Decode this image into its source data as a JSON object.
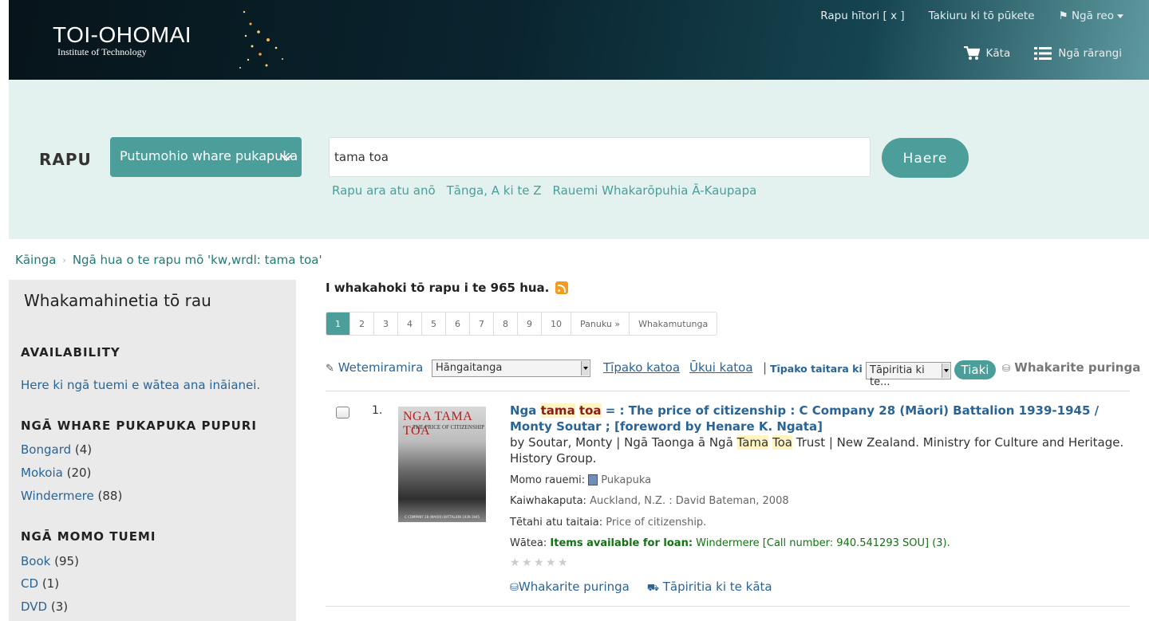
{
  "header": {
    "brand": "TOI-OHOMAI",
    "brand_sub": "Institute of Technology",
    "top_links": [
      "Rapu hītori [ x ]",
      "Takiuru ki tō pūkete",
      "Ngā reo"
    ],
    "cart_label": "Kāta",
    "lists_label": "Ngā rārangi"
  },
  "search": {
    "label": "RAPU",
    "scope": "Putumohio whare pukapuka",
    "query": "tama toa",
    "go_label": "Haere",
    "links": [
      "Rapu ara atu anō",
      "Tānga, A ki te Z",
      "Rauemi Whakarōpuhia Ā-Kaupapa"
    ]
  },
  "breadcrumb": {
    "home": "Kāinga",
    "current": "Ngā hua o te rapu mō 'kw,wrdl: tama toa'"
  },
  "sidebar": {
    "title": "Whakamahinetia tō rau",
    "availability_heading": "AVAILABILITY",
    "availability_link": "Here ki ngā tuemi e wātea ana ināianei.",
    "libraries_heading": "NGĀ WHARE PUKAPUKA PUPURI",
    "libraries": [
      {
        "name": "Bongard",
        "count": "(4)"
      },
      {
        "name": "Mokoia",
        "count": "(20)"
      },
      {
        "name": "Windermere",
        "count": "(88)"
      }
    ],
    "types_heading": "NGĀ MOMO TUEMI",
    "types": [
      {
        "name": "Book",
        "count": "(95)"
      },
      {
        "name": "CD",
        "count": "(1)"
      },
      {
        "name": "DVD",
        "count": "(3)"
      }
    ]
  },
  "results": {
    "hits_text": "I whakahoki tō rapu i te 965 hua.",
    "pages": [
      "1",
      "2",
      "3",
      "4",
      "5",
      "6",
      "7",
      "8",
      "9",
      "10",
      "Panuku »",
      "Whakamutunga"
    ],
    "active_page": "1",
    "toolbar": {
      "highlight": "Wetemiramira",
      "sort": "Hāngaitanga",
      "select_all": "Tīpako katoa",
      "clear_all": "Ūkui katoa",
      "add_to_label": "Tīpako taitara ki te:",
      "add_to_select": "Tāpiritia ki te...",
      "save": "Tiaki",
      "place_hold": "Whakarite puringa"
    },
    "items": [
      {
        "number": "1.",
        "cover_title": "NGA TAMA TOA",
        "cover_sub": "THE PRICE OF CITIZENSHIP",
        "cover_foot": "C COMPANY 28 (MAORI) BATTALION 1939-1945",
        "title_pre": "Nga ",
        "title_hl1": "tama",
        "title_hl2": "toa",
        "title_post": " = : The price of citizenship : C Company 28 (Māori) Battalion 1939-1945 / Monty Soutar ; [foreword by Henare K. Ngata]",
        "author_pre": "by Soutar, Monty | Ngā Taonga ā Ngā ",
        "author_hl1": "Tama",
        "author_hl2": "Toa",
        "author_post": " Trust | New Zealand. Ministry for Culture and Heritage. History Group.",
        "type_label": "Momo rauemi:",
        "type_value": "Pukapuka",
        "publisher_label": "Kaiwhakaputa:",
        "publisher_value": "Auckland, N.Z. : David Bateman, 2008",
        "other_title_label": "Tētahi atu taitaia:",
        "other_title_value": "Price of citizenship.",
        "avail_label": "Wātea:",
        "avail_bold": "Items available for loan:",
        "avail_value": "Windermere [Call number: 940.541293 SOU] (3).",
        "rating": 0,
        "hold_action": "Whakarite puringa",
        "cart_action": "Tāpiritia ki te kāta"
      }
    ]
  },
  "colors": {
    "accent": "#4b9e9a",
    "link": "#2a6496",
    "band": "#e3f2ef",
    "available": "#167016"
  }
}
